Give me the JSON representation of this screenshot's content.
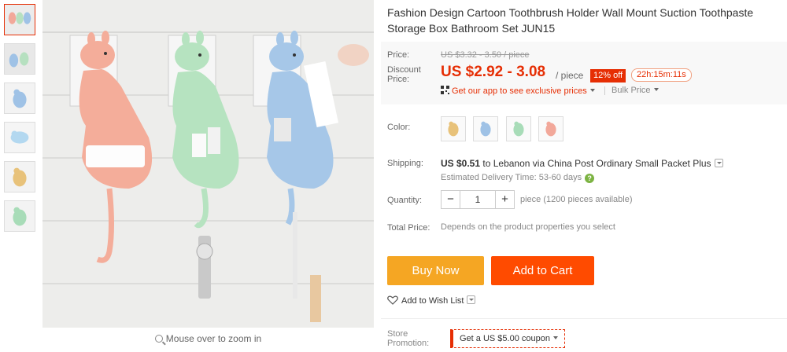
{
  "product": {
    "title": "Fashion Design Cartoon Toothbrush Holder Wall Mount Suction Toothpaste Storage Box Bathroom Set JUN15",
    "zoom_hint": "Mouse over to zoom in"
  },
  "thumbnails": [
    {
      "name": "thumb-1"
    },
    {
      "name": "thumb-2"
    },
    {
      "name": "thumb-3"
    },
    {
      "name": "thumb-4"
    },
    {
      "name": "thumb-5"
    },
    {
      "name": "thumb-6"
    }
  ],
  "price": {
    "price_label": "Price:",
    "original": "US $3.32 - 3.50 / piece",
    "discount_label_1": "Discount",
    "discount_label_2": "Price:",
    "current": "US $2.92 - 3.08",
    "unit": "/ piece",
    "off_badge": "12% off",
    "timer": "22h:15m:11s",
    "app_offer": "Get our app to see exclusive prices",
    "bulk_price": "Bulk Price"
  },
  "color": {
    "label": "Color:",
    "options": [
      "orange",
      "blue",
      "green",
      "pink"
    ]
  },
  "shipping": {
    "label": "Shipping:",
    "cost": "US $0.51",
    "destination": "to Lebanon via China Post Ordinary Small Packet Plus",
    "estimate": "Estimated Delivery Time: 53-60 days",
    "help_icon": "?"
  },
  "quantity": {
    "label": "Quantity:",
    "minus": "−",
    "value": "1",
    "plus": "+",
    "info": "piece (1200 pieces available)"
  },
  "total": {
    "label": "Total Price:",
    "value": "Depends on the product properties you select"
  },
  "actions": {
    "buy_now": "Buy Now",
    "add_to_cart": "Add to Cart",
    "wishlist": "Add to Wish List"
  },
  "promotion": {
    "label_1": "Store",
    "label_2": "Promotion:",
    "coupon": "Get a US $5.00 coupon"
  },
  "colors": {
    "accent": "#e62e04",
    "buy_now": "#f5a623",
    "add_to_cart": "#ff4b00",
    "price_bg": "#f8f8f8"
  }
}
